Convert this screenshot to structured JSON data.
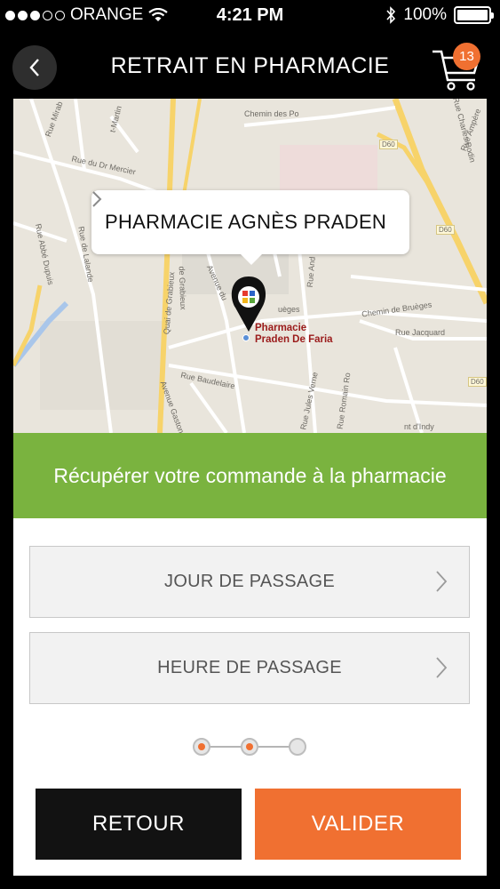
{
  "status_bar": {
    "carrier": "ORANGE",
    "time": "4:21 PM",
    "battery": "100%",
    "signal_icon": "signal-dots-icon",
    "wifi_icon": "wifi-icon",
    "bluetooth_icon": "bluetooth-icon"
  },
  "header": {
    "title": "RETRAIT EN PHARMACIE",
    "cart_count": "13",
    "back_icon": "chevron-left-icon",
    "cart_icon": "shopping-cart-icon"
  },
  "map": {
    "callout_title": "PHARMACIE AGNÈS PRADEN",
    "pin_label_line1": "Pharmacie",
    "pin_label_line2": "Praden De Faria",
    "streets": {
      "s1": "Chemin des Po",
      "s2": "Rue du Dr Mercier",
      "s3": "Rue de Lalande",
      "s4": "Rue Abbé Dupuis",
      "s5": "Quai de Grabieux",
      "s6": "de Grabieux",
      "s7": "Avenue du",
      "s8": "Rue And",
      "s9": "Chemin de Bruèges",
      "s10": "Rue Jacquard",
      "s11": "Rue Baudelaire",
      "s12": "Rue Jules Verne",
      "s13": "Rue Romain Ro",
      "s14": "Avenue Gaston",
      "s15": "nt d'Indy",
      "s16": "uèges",
      "s17": "Rue Charles Bodin",
      "s18": "Rue Mirab",
      "s19": "t-Martin",
      "s20": "Rue Ampère"
    },
    "road_tags": {
      "d60_top": "D60",
      "d60_mid": "D60",
      "d60_bottom": "D60"
    }
  },
  "banner": {
    "text": "Récupérer votre commande à la pharmacie"
  },
  "form": {
    "day_label": "JOUR DE PASSAGE",
    "hour_label": "HEURE DE PASSAGE"
  },
  "progress": {
    "current_step": 2,
    "total_steps": 3
  },
  "actions": {
    "back_label": "RETOUR",
    "validate_label": "VALIDER"
  },
  "colors": {
    "accent": "#f07031",
    "banner_green": "#7ab33f",
    "background": "#000000"
  }
}
